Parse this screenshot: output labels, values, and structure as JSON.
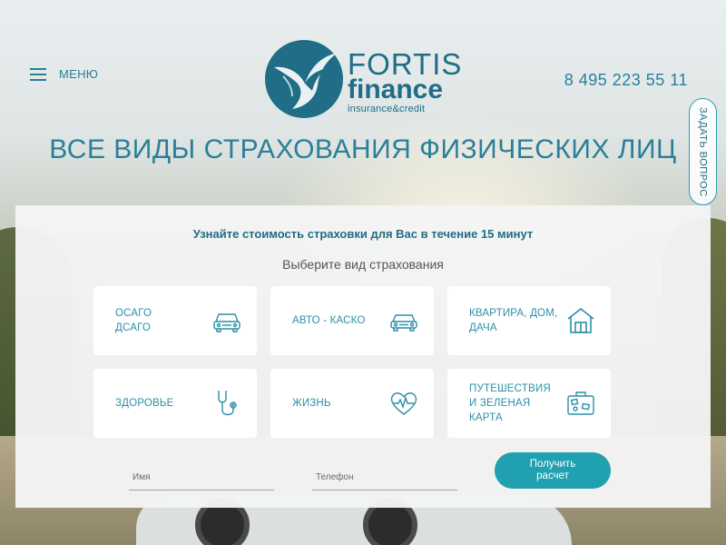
{
  "header": {
    "menu_label": "МЕНЮ",
    "logo": {
      "line1": "FORTIS",
      "line2": "finance",
      "line3": "insurance&credit"
    },
    "phone": "8 495 223 55 11",
    "ask_question": "ЗАДАТЬ ВОПРОС"
  },
  "hero": {
    "title": "ВСЕ ВИДЫ СТРАХОВАНИЯ ФИЗИЧЕСКИХ ЛИЦ"
  },
  "form": {
    "heading": "Узнайте стоимость страховки для Вас в течение 15 минут",
    "subheading": "Выберите вид страхования",
    "tiles": [
      {
        "label": "ОСАГО ДСАГО",
        "icon": "car-front-icon"
      },
      {
        "label": "АВТО - КАСКО",
        "icon": "car-front-icon"
      },
      {
        "label": "КВАРТИРА, ДОМ, ДАЧА",
        "icon": "house-icon"
      },
      {
        "label": "ЗДОРОВЬЕ",
        "icon": "stethoscope-icon"
      },
      {
        "label": "ЖИЗНЬ",
        "icon": "heart-pulse-icon"
      },
      {
        "label": "ПУТЕШЕСТВИЯ И ЗЕЛЕНАЯ КАРТА",
        "icon": "suitcase-icon"
      }
    ],
    "name_placeholder": "Имя",
    "phone_placeholder": "Телефон",
    "submit_label": "Получить расчет"
  },
  "colors": {
    "accent": "#2a7f9a",
    "button": "#21a0b0",
    "logo": "#1f6d86"
  }
}
